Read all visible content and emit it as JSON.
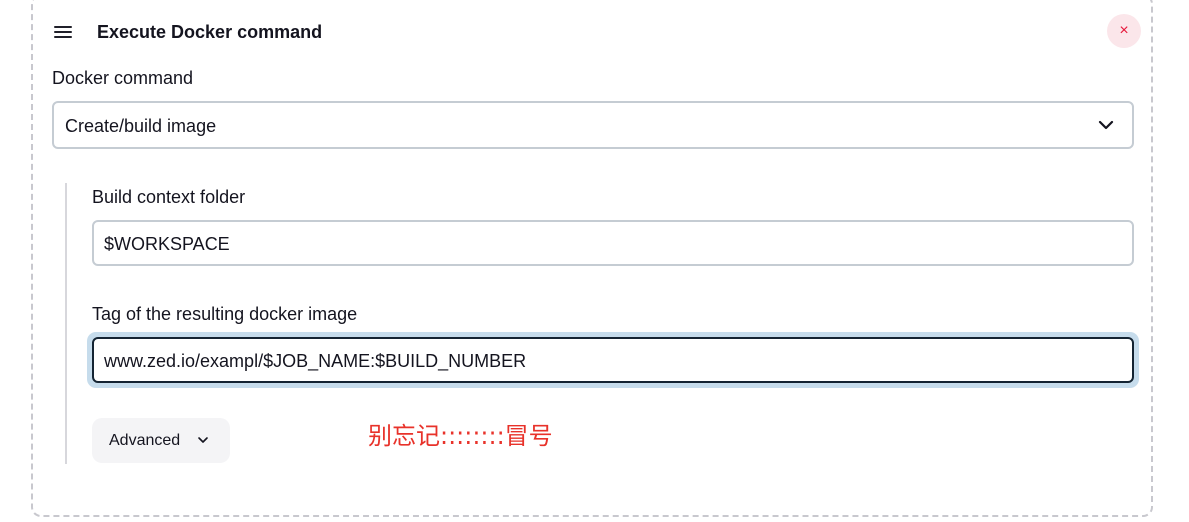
{
  "step": {
    "title": "Execute Docker command",
    "handle_icon": "drag-handle-icon",
    "close_icon": "close-icon",
    "close_symbol": "×"
  },
  "docker_command": {
    "label": "Docker command",
    "selected": "Create/build image",
    "chevron_icon": "chevron-down-icon"
  },
  "build_context": {
    "label": "Build context folder",
    "value": "$WORKSPACE"
  },
  "tag": {
    "label": "Tag of the resulting docker image",
    "value": "www.zed.io/exampl/$JOB_NAME:$BUILD_NUMBER"
  },
  "advanced": {
    "label": "Advanced",
    "chevron_icon": "chevron-down-icon"
  },
  "annotation": {
    "text": "别忘记::::::::冒号",
    "color": "#e8322a"
  },
  "colors": {
    "focus_border": "#142433",
    "focus_ring": "#c6dcec",
    "delete_bg": "#fbe6ea",
    "delete_fg": "#e6163a"
  }
}
